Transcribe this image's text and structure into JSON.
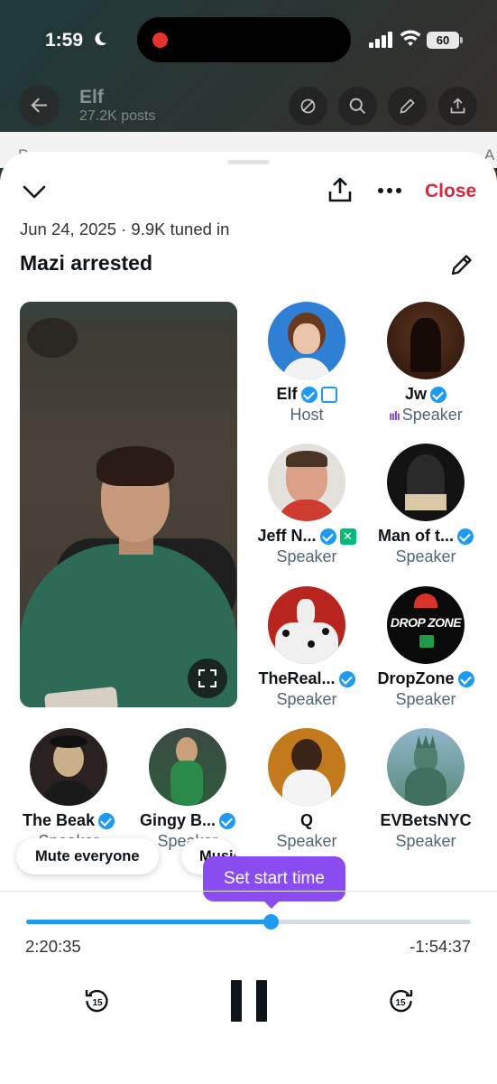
{
  "status": {
    "time": "1:59",
    "battery": "60"
  },
  "background": {
    "name": "Elf",
    "posts": "27.2K posts",
    "strip_left": "P",
    "strip_right": "A"
  },
  "sheet": {
    "close_label": "Close",
    "meta": "Jun 24, 2025 · 9.9K tuned in",
    "title": "Mazi arrested"
  },
  "speakers": [
    {
      "name": "Elf",
      "role": "Host",
      "avatar_color": "#2f7fd4"
    },
    {
      "name": "Jw",
      "role": "Speaker",
      "avatar_color": "#4a2a1c"
    },
    {
      "name": "Jeff N...",
      "role": "Speaker",
      "avatar_color": "#c9b9a8"
    },
    {
      "name": "Man of t...",
      "role": "Speaker",
      "avatar_color": "#1e1e1e"
    },
    {
      "name": "TheReal...",
      "role": "Speaker",
      "avatar_color": "#b8251e"
    },
    {
      "name": "DropZone",
      "role": "Speaker",
      "avatar_color": "#0a0a0a"
    },
    {
      "name": "The Beak",
      "role": "Speaker",
      "avatar_color": "#3b2a22"
    },
    {
      "name": "Gingy B...",
      "role": "Speaker",
      "avatar_color": "#2f5a3a"
    },
    {
      "name": "Q",
      "role": "Speaker",
      "avatar_color": "#7a5a2a"
    },
    {
      "name": "EVBetsNYC",
      "role": "Speaker",
      "avatar_color": "#5a8a7a"
    }
  ],
  "dropzone_logo": "DROP ZONE",
  "controls": {
    "mute_everyone": "Mute everyone",
    "music": "Music",
    "tooltip": "Set start time",
    "elapsed": "2:20:35",
    "remaining": "-1:54:37",
    "progress": 0.55,
    "skip_back": "15",
    "skip_forward": "15"
  },
  "colors": {
    "accent": "#1d9bf0",
    "close": "#d9283d",
    "tooltip": "#8a4cf0",
    "speaking": "#794bc4"
  }
}
